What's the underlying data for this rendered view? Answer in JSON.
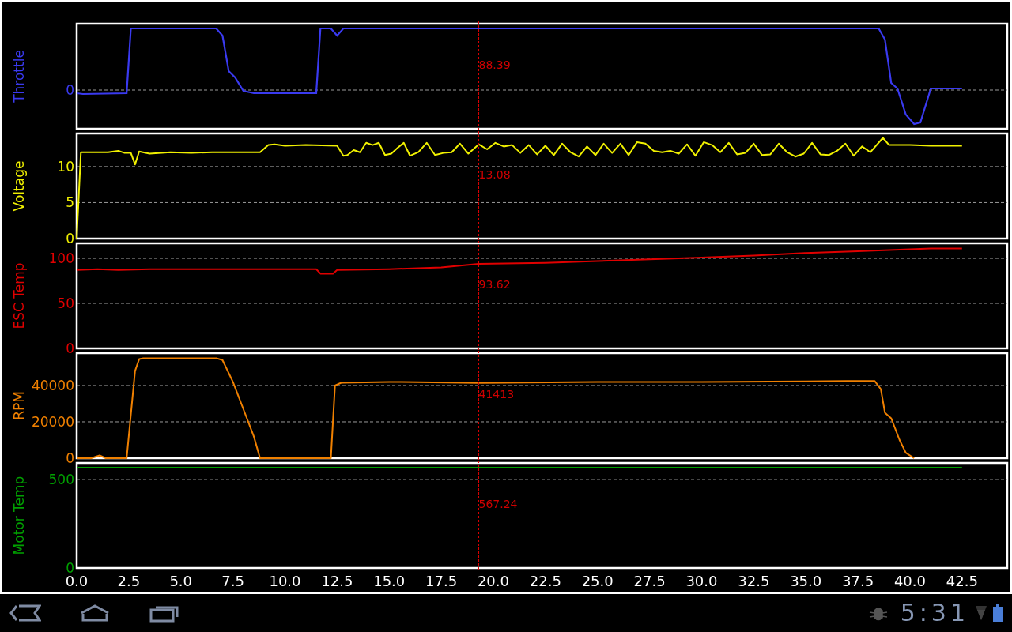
{
  "panels": [
    {
      "kind": "picture",
      "ylabel": "Throttle",
      "tick_labels": [
        "0"
      ],
      "cursor_label": "88.39"
    },
    {
      "kind": "chart",
      "chart_data": {
        "type": "line",
        "ylabel": "Voltage",
        "xlim": [
          0,
          44.67
        ],
        "ylim": [
          0,
          14.6
        ],
        "yticks": [
          0,
          5,
          10
        ],
        "x": [
          0,
          0.2,
          1.5,
          2.0,
          2.3,
          2.6,
          2.8,
          3.0,
          3.5,
          4.5,
          5.5,
          6.5,
          7.5,
          8.5,
          8.8,
          9.2,
          9.5,
          10,
          11,
          12.5,
          12.8,
          13.0,
          13.3,
          13.6,
          13.9,
          14.2,
          14.5,
          14.8,
          15.1,
          15.4,
          15.7,
          16,
          16.4,
          16.8,
          17.2,
          17.6,
          18,
          18.4,
          18.8,
          19.3,
          19.7,
          20.1,
          20.5,
          20.9,
          21.3,
          21.7,
          22.1,
          22.5,
          22.9,
          23.3,
          23.7,
          24.1,
          24.5,
          24.9,
          25.3,
          25.7,
          26.1,
          26.5,
          26.9,
          27.3,
          27.7,
          28.1,
          28.5,
          28.9,
          29.3,
          29.7,
          30.1,
          30.5,
          30.9,
          31.3,
          31.7,
          32.1,
          32.5,
          32.9,
          33.3,
          33.7,
          34.1,
          34.5,
          34.9,
          35.3,
          35.7,
          36.1,
          36.5,
          36.9,
          37.3,
          37.7,
          38.1,
          38.7,
          39.0,
          40,
          41,
          42.5
        ],
        "series": [
          {
            "color": "#f0f000",
            "values": [
              0,
              12,
              12,
              12.2,
              11.9,
              11.9,
              10.3,
              12.1,
              11.8,
              12,
              11.9,
              12,
              12,
              12,
              12,
              13,
              13.1,
              12.9,
              13,
              12.9,
              11.5,
              11.6,
              12.3,
              12.0,
              13.3,
              13.0,
              13.3,
              11.6,
              11.8,
              12.6,
              13.3,
              11.5,
              12.0,
              13.3,
              11.6,
              11.9,
              12.0,
              13.2,
              11.8,
              13.1,
              12.4,
              13.3,
              12.8,
              13.0,
              11.9,
              13.0,
              11.7,
              12.9,
              11.6,
              13.2,
              12.0,
              11.4,
              12.8,
              11.6,
              13.2,
              11.9,
              13.2,
              11.6,
              13.4,
              13.2,
              12.2,
              12.0,
              12.2,
              11.8,
              13.1,
              11.5,
              13.4,
              13.0,
              12.0,
              13.3,
              11.7,
              11.9,
              13.2,
              11.6,
              11.7,
              13.2,
              12.0,
              11.4,
              11.8,
              13.3,
              11.7,
              11.6,
              12.2,
              13.2,
              11.5,
              12.8,
              12.0,
              14.0,
              13.0,
              13.0,
              12.9,
              12.9
            ]
          }
        ],
        "ref_lines": [
          {
            "axis": "x",
            "value": 19.3
          }
        ],
        "annotations": [
          "13.08"
        ]
      }
    },
    {
      "kind": "chart",
      "chart_data": {
        "type": "line",
        "ylabel": "ESC Temp",
        "xlim": [
          0,
          44.67
        ],
        "ylim": [
          0,
          116.7
        ],
        "yticks": [
          0,
          50,
          100
        ],
        "x": [
          0,
          1,
          2,
          3.5,
          5,
          6.5,
          7,
          8,
          10,
          11.5,
          11.7,
          12.3,
          12.5,
          15,
          17.5,
          19.3,
          22.5,
          25,
          27.5,
          30,
          32.5,
          35,
          37.5,
          40,
          41,
          42.5
        ],
        "series": [
          {
            "color": "#e00000",
            "values": [
              87,
              88,
              87,
              88,
              88,
              88,
              88,
              88,
              88,
              88,
              83,
              83,
              87,
              88,
              90,
              94,
              95,
              97,
              99,
              101,
              103,
              106,
              108,
              110,
              111,
              111
            ]
          }
        ],
        "ref_lines": [
          {
            "axis": "x",
            "value": 19.3
          }
        ],
        "annotations": [
          "93.62"
        ]
      }
    },
    {
      "kind": "chart",
      "chart_data": {
        "type": "line",
        "ylabel": "RPM",
        "xlim": [
          0,
          44.67
        ],
        "ylim": [
          0,
          57800
        ],
        "yticks": [
          0,
          20000,
          40000
        ],
        "x": [
          0,
          0.7,
          1.1,
          1.4,
          2.4,
          2.8,
          3.0,
          3.2,
          5,
          6.7,
          7.0,
          7.5,
          7.9,
          8.5,
          8.8,
          12.2,
          12.4,
          12.7,
          15,
          19.3,
          25,
          30,
          35,
          37,
          38.3,
          38.6,
          38.8,
          39.1,
          39.5,
          39.8,
          40.2
        ],
        "series": [
          {
            "color": "#f08000",
            "values": [
              0,
              0,
              1500,
              0,
              0,
              48000,
              54500,
              55000,
              55000,
              55000,
              54000,
              42000,
              30000,
              12000,
              0,
              0,
              40000,
              41500,
              42000,
              41400,
              42000,
              42000,
              42300,
              42500,
              42500,
              38000,
              25000,
              22000,
              10000,
              3000,
              0
            ]
          }
        ],
        "ref_lines": [
          {
            "axis": "x",
            "value": 19.3
          }
        ],
        "annotations": [
          "41413"
        ]
      }
    },
    {
      "kind": "chart",
      "chart_data": {
        "type": "line",
        "ylabel": "Motor Temp",
        "xlim": [
          0,
          44.67
        ],
        "ylim": [
          0,
          594
        ],
        "yticks": [
          0,
          500
        ],
        "xticks": [
          {
            "value": 0,
            "label": "0.0"
          },
          {
            "value": 2.5,
            "label": "2.5"
          },
          {
            "value": 5,
            "label": "5.0"
          },
          {
            "value": 7.5,
            "label": "7.5"
          },
          {
            "value": 10,
            "label": "10.0"
          },
          {
            "value": 12.5,
            "label": "12.5"
          },
          {
            "value": 15,
            "label": "15.0"
          },
          {
            "value": 17.5,
            "label": "17.5"
          },
          {
            "value": 20,
            "label": "20.0"
          },
          {
            "value": 22.5,
            "label": "22.5"
          },
          {
            "value": 25,
            "label": "25.0"
          },
          {
            "value": 27.5,
            "label": "27.5"
          },
          {
            "value": 30,
            "label": "30.0"
          },
          {
            "value": 32.5,
            "label": "32.5"
          },
          {
            "value": 35,
            "label": "35.0"
          },
          {
            "value": 37.5,
            "label": "37.5"
          },
          {
            "value": 40,
            "label": "40.0"
          },
          {
            "value": 42.5,
            "label": "42.5"
          }
        ],
        "x": [
          0,
          42.5
        ],
        "series": [
          {
            "color": "#00a000",
            "values": [
              567,
              567
            ]
          }
        ],
        "ref_lines": [
          {
            "axis": "x",
            "value": 19.3
          }
        ],
        "annotations": [
          "567.24"
        ]
      }
    }
  ],
  "nav_bar": {
    "clock": "5:31"
  }
}
